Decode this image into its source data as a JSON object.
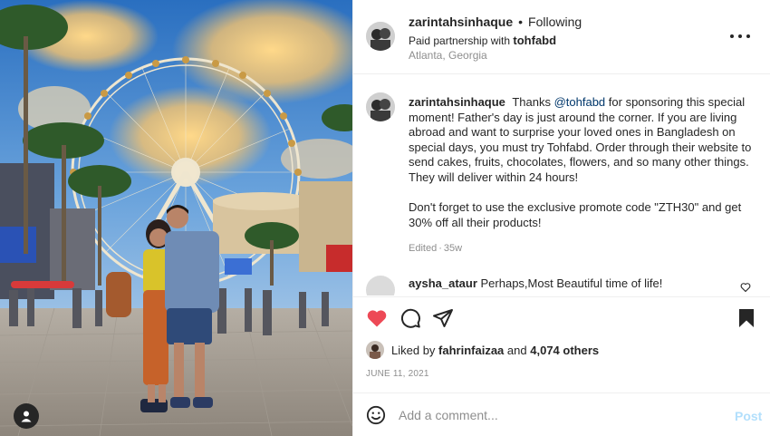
{
  "post": {
    "author": "zarintahsinhaque",
    "follow_status": "Following",
    "partnership_prefix": "Paid partnership with",
    "partner": "tohfabd",
    "location": "Atlanta, Georgia"
  },
  "caption": {
    "username": "zarintahsinhaque",
    "pre_mention": "Thanks",
    "mention": "@tohfabd",
    "paragraph1": "for sponsoring this special moment! Father's day is just around the corner. If you are living abroad and want to surprise your loved ones in Bangladesh on special days, you must try Tohfabd. Order through their website to send cakes, fruits, chocolates, flowers, and so many other things. They will deliver within 24 hours!",
    "paragraph2": "Don't forget to use the exclusive promote code \"ZTH30\" and get 30% off all their products!",
    "status": "Edited",
    "age": "35w"
  },
  "comment": {
    "username": "aysha_ataur",
    "text": "Perhaps,Most Beautiful time of life!"
  },
  "likes": {
    "prefix": "Liked by",
    "user": "fahrinfaizaa",
    "middle": "and",
    "others": "4,074 others"
  },
  "date": "JUNE 11, 2021",
  "add_comment": {
    "placeholder": "Add a comment...",
    "post_label": "Post"
  },
  "icons": {
    "like": "heart-filled-icon",
    "comment": "comment-bubble-icon",
    "share": "paper-plane-icon",
    "save": "bookmark-filled-icon",
    "more": "more-horizontal-icon",
    "emoji": "emoji-smile-icon",
    "tag": "user-tag-icon"
  },
  "colors": {
    "like_red": "#ed4956",
    "link_blue": "#00376b",
    "post_disabled": "#b2dffc",
    "muted": "#8e8e8e"
  }
}
